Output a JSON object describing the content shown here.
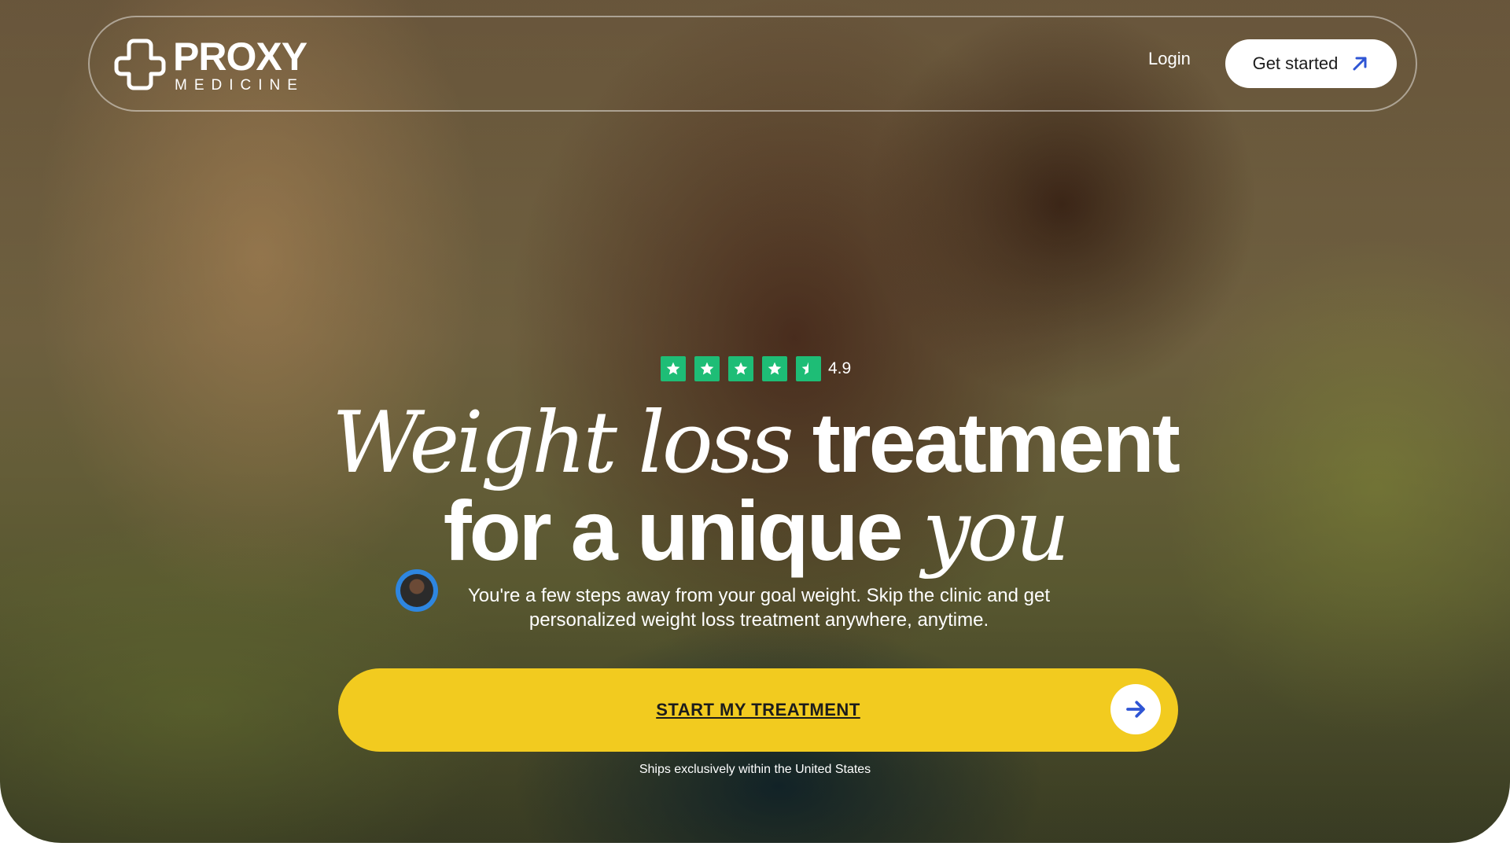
{
  "brand": {
    "name_primary": "PROXY",
    "name_secondary": "MEDICINE"
  },
  "nav": {
    "login_label": "Login",
    "get_started_label": "Get started"
  },
  "rating": {
    "value": "4.9",
    "stars": 4.5,
    "star_color": "#1ebd76"
  },
  "hero": {
    "headline_line1_italic": "Weight loss",
    "headline_line1_bold": "treatment",
    "headline_line2_bold": "for a unique",
    "headline_line2_italic": "you",
    "subtext": "You're a few steps away from your goal weight. Skip the clinic and get personalized weight loss treatment anywhere, anytime."
  },
  "cta": {
    "label": "START MY TREATMENT",
    "color": "#f2cb1f",
    "arrow_color": "#2f55d4"
  },
  "shipping_note": "Ships exclusively within the United States",
  "icons": {
    "logo": "medical-cross-outline-icon",
    "get_started": "arrow-up-right-icon",
    "cta": "arrow-right-icon",
    "rating": "star-icon"
  }
}
